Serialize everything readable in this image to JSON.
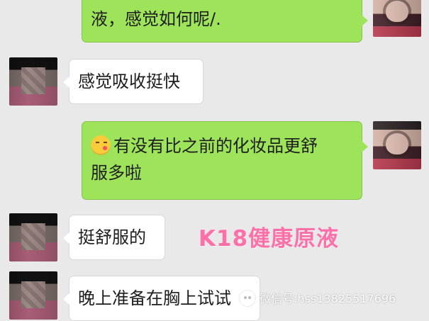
{
  "chat": {
    "messages": [
      {
        "side": "right",
        "text": "液，感觉如何呢/."
      },
      {
        "side": "left",
        "text": "感觉吸收挺快"
      },
      {
        "side": "right",
        "emoji": "kiss-face-icon",
        "line1": "有没有比之前的化妆品更舒",
        "line2": "服多啦"
      },
      {
        "side": "left",
        "text": "挺舒服的"
      },
      {
        "side": "left",
        "text": "晚上准备在胸上试试"
      }
    ]
  },
  "overlays": {
    "brand": "K18健康原液",
    "wechat": "微信号:hss13825517696"
  },
  "colors": {
    "background": "#e9e9e9",
    "incoming": "#ffffff",
    "outgoing": "#9ee45a",
    "watermark": "#ff6fa8"
  }
}
